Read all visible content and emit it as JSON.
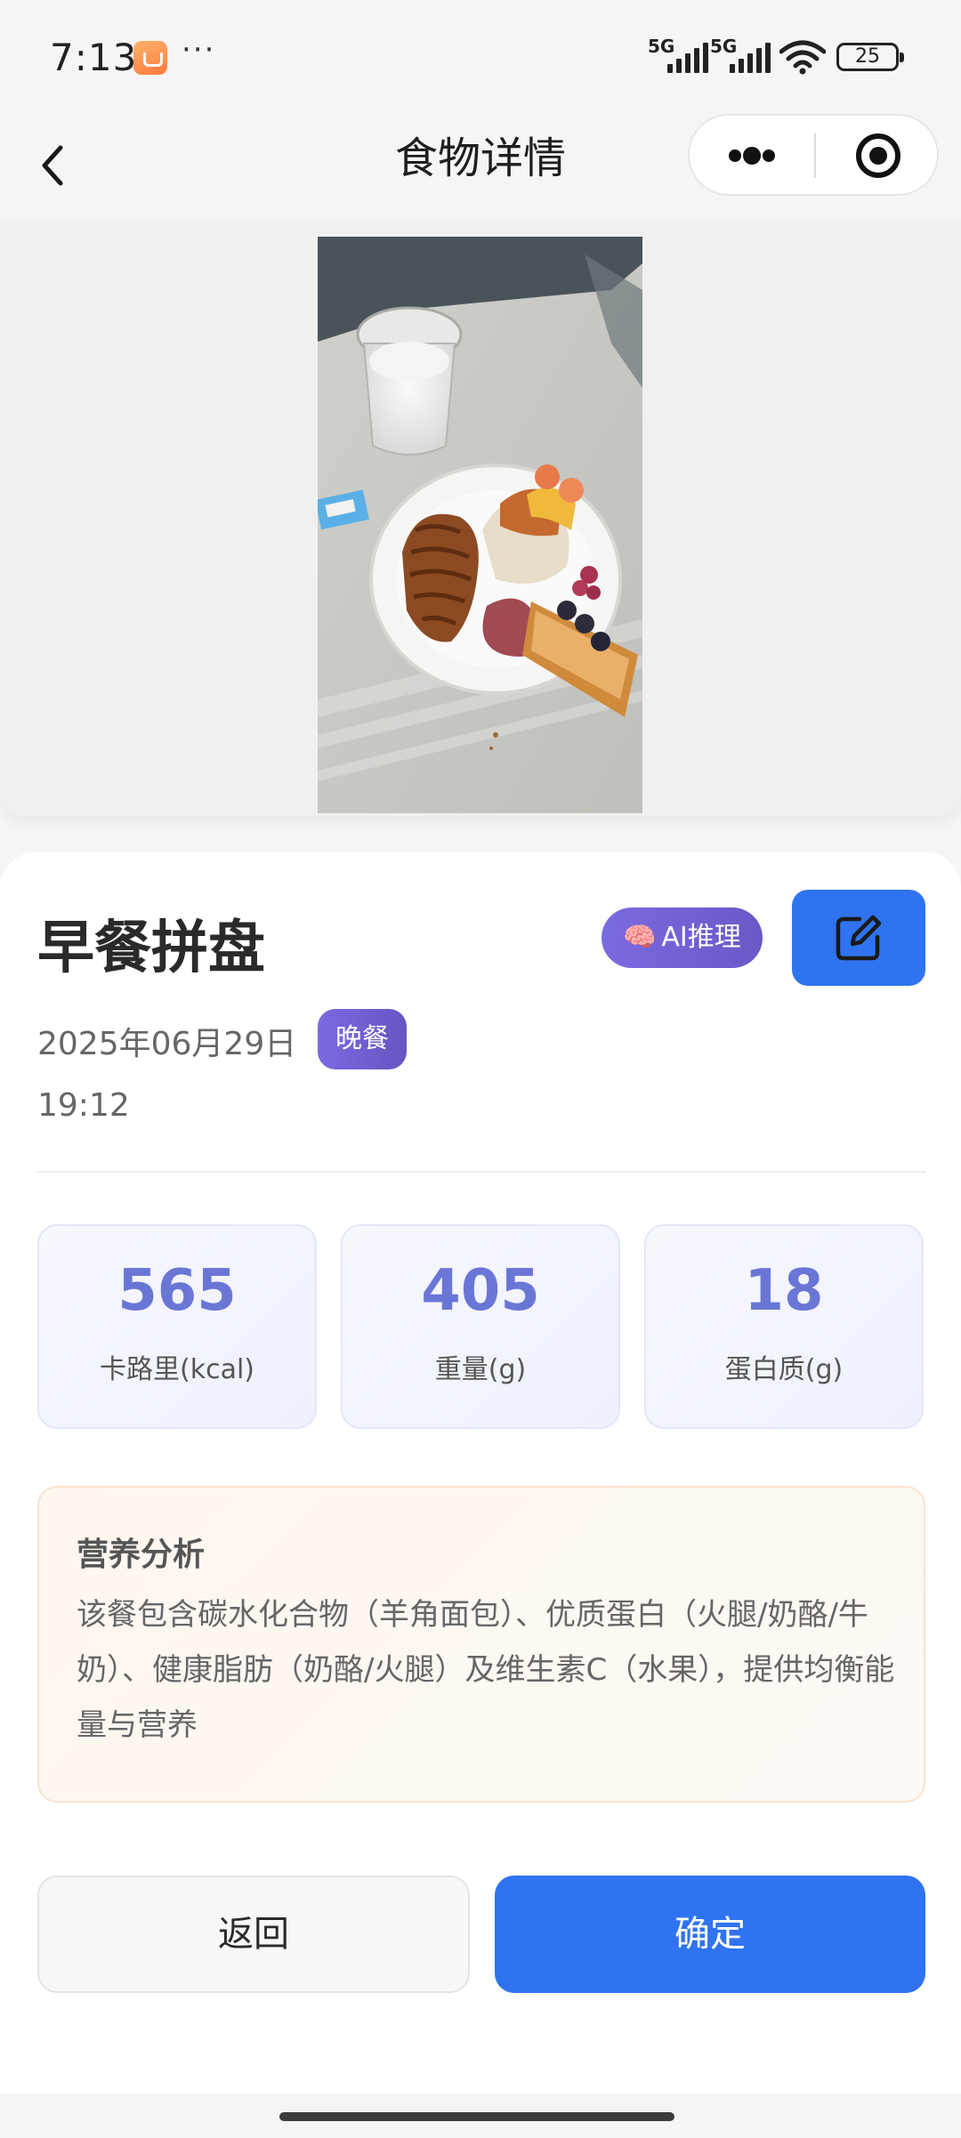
{
  "status_bar": {
    "time": "7:13",
    "dots": "···",
    "signal_1_label": "5G",
    "signal_2_label": "5G",
    "battery": "25",
    "app_icon": "shopping-bag-icon",
    "wifi_icon": "wifi-icon"
  },
  "nav": {
    "title": "食物详情",
    "back_icon": "chevron-left-icon",
    "more_icon": "more-dots-icon",
    "close_icon": "target-close-icon"
  },
  "photo": {
    "description_icon": "food-photo",
    "subject": "breakfast plate"
  },
  "food": {
    "name": "早餐拼盘",
    "ai_badge_icon": "🧠",
    "ai_badge_label": "AI推理",
    "edit_icon": "edit-icon",
    "date": "2025年06月29日",
    "meal_type": "晚餐",
    "time": "19:12"
  },
  "stats": [
    {
      "value": "565",
      "label": "卡路里(kcal)"
    },
    {
      "value": "405",
      "label": "重量(g)"
    },
    {
      "value": "18",
      "label": "蛋白质(g)"
    }
  ],
  "analysis": {
    "title": "营养分析",
    "text": "该餐包含碳水化合物（羊角面包）、优质蛋白（火腿/奶酪/牛奶）、健康脂肪（奶酪/火腿）及维生素C（水果），提供均衡能量与营养"
  },
  "actions": {
    "return_label": "返回",
    "confirm_label": "确定"
  },
  "colors": {
    "primary": "#2f73f0",
    "badge_purple": "#6f5fd3",
    "stat_value": "#6a76d6",
    "analysis_bg": "#fff6ef"
  }
}
